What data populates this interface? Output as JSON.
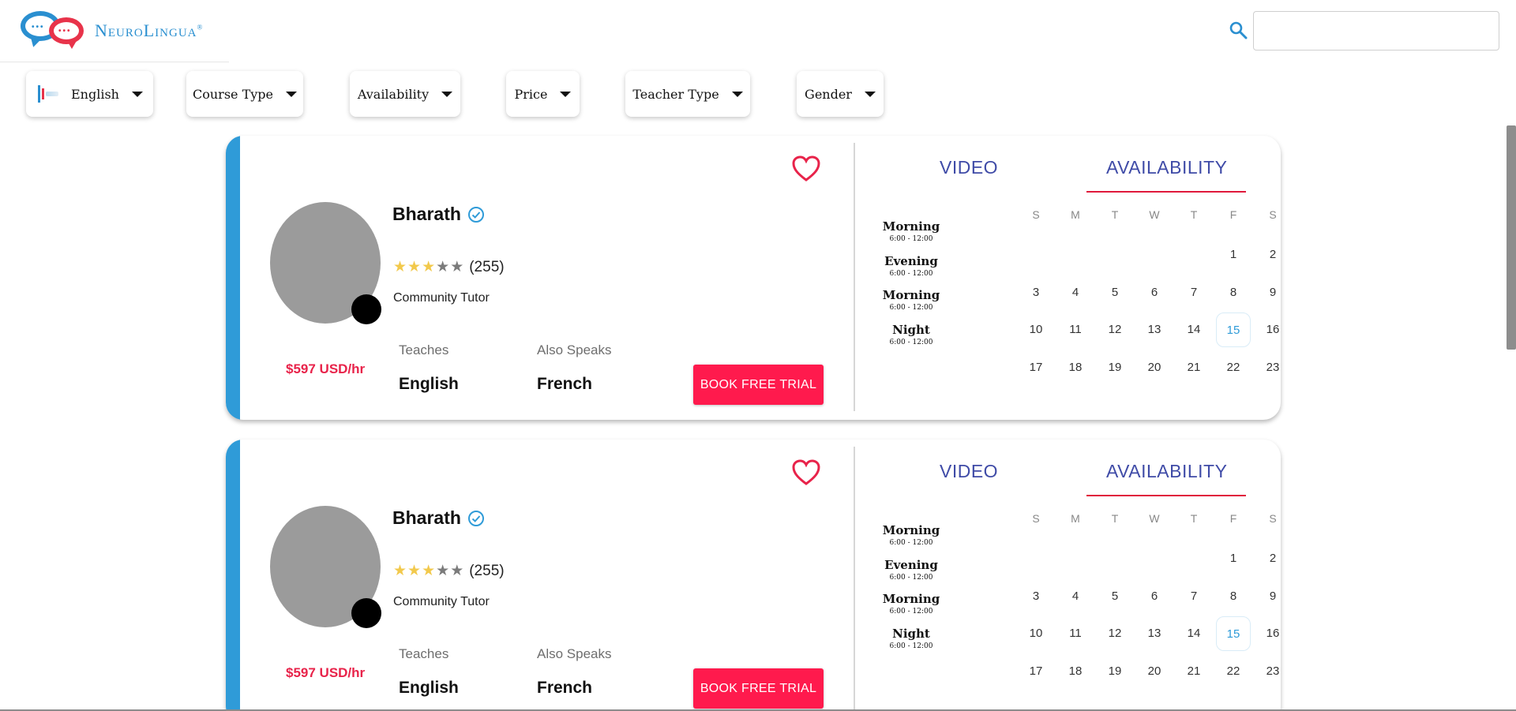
{
  "brand": {
    "name": "NeuroLingua",
    "registered": "®"
  },
  "search": {
    "placeholder": "",
    "value": ""
  },
  "filters": [
    {
      "label": "English",
      "icon": "language-flag-icon"
    },
    {
      "label": "Course Type"
    },
    {
      "label": "Availability"
    },
    {
      "label": "Price"
    },
    {
      "label": "Teacher Type"
    },
    {
      "label": "Gender"
    }
  ],
  "colors": {
    "accent": "#2f9bd8",
    "cta": "#ff1a4d",
    "tab": "#3f4ba7",
    "price": "#e8234a"
  },
  "tutors": [
    {
      "name": "Bharath",
      "rating": 3,
      "rating_max": 5,
      "reviews": "(255)",
      "type": "Community Tutor",
      "price": "$597 USD/hr",
      "teaches_label": "Teaches",
      "teaches": "English",
      "speaks_label": "Also Speaks",
      "speaks": "French",
      "book_label": "BOOK FREE TRIAL",
      "tabs": {
        "video": "VIDEO",
        "availability": "AVAILABILITY"
      },
      "weekdays": [
        "S",
        "M",
        "T",
        "W",
        "T",
        "F",
        "S"
      ],
      "slots": [
        {
          "name": "Morning",
          "time": "6:00 - 12:00"
        },
        {
          "name": "Evening",
          "time": "6:00 - 12:00"
        },
        {
          "name": "Morning",
          "time": "6:00 - 12:00"
        },
        {
          "name": "Night",
          "time": "6:00 - 12:00"
        }
      ],
      "days": [
        "1",
        "2",
        "3",
        "4",
        "5",
        "6",
        "7",
        "8",
        "9",
        "10",
        "11",
        "12",
        "13",
        "14",
        "15",
        "16",
        "17",
        "18",
        "19",
        "20",
        "21",
        "22",
        "23"
      ],
      "highlighted_day": "15"
    },
    {
      "name": "Bharath",
      "rating": 3,
      "rating_max": 5,
      "reviews": "(255)",
      "type": "Community Tutor",
      "price": "$597 USD/hr",
      "teaches_label": "Teaches",
      "teaches": "English",
      "speaks_label": "Also Speaks",
      "speaks": "French",
      "book_label": "BOOK FREE TRIAL",
      "tabs": {
        "video": "VIDEO",
        "availability": "AVAILABILITY"
      },
      "weekdays": [
        "S",
        "M",
        "T",
        "W",
        "T",
        "F",
        "S"
      ],
      "slots": [
        {
          "name": "Morning",
          "time": "6:00 - 12:00"
        },
        {
          "name": "Evening",
          "time": "6:00 - 12:00"
        },
        {
          "name": "Morning",
          "time": "6:00 - 12:00"
        },
        {
          "name": "Night",
          "time": "6:00 - 12:00"
        }
      ],
      "days": [
        "1",
        "2",
        "3",
        "4",
        "5",
        "6",
        "7",
        "8",
        "9",
        "10",
        "11",
        "12",
        "13",
        "14",
        "15",
        "16",
        "17",
        "18",
        "19",
        "20",
        "21",
        "22",
        "23"
      ],
      "highlighted_day": "15"
    }
  ]
}
